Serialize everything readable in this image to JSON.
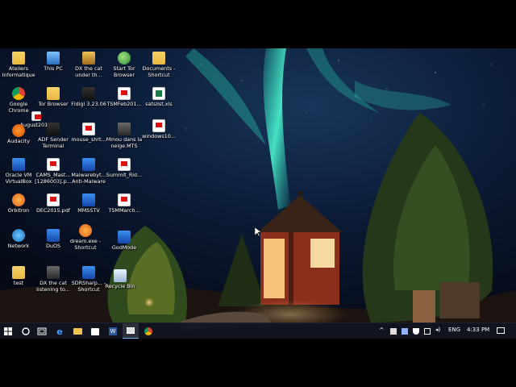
{
  "desktop": {
    "icons": [
      {
        "label": "Ateliers Informatique",
        "icon": "folder-icon"
      },
      {
        "label": "This PC",
        "icon": "computer-icon"
      },
      {
        "label": "DX the cat under th...",
        "icon": "picture-icon"
      },
      {
        "label": "Start Tor Browser",
        "icon": "tor-globe-icon"
      },
      {
        "label": "Documents - Shortcut",
        "icon": "folder-icon"
      },
      {
        "label": "Google Chrome",
        "icon": "chrome-icon"
      },
      {
        "label": "Tor Browser",
        "icon": "folder-icon"
      },
      {
        "label": "Fldigi 3.23.06",
        "icon": "app-icon"
      },
      {
        "label": "TSMFeb201...",
        "icon": "pdf-document-icon"
      },
      {
        "label": "satslist.xls",
        "icon": "excel-document-icon"
      },
      {
        "label": "August201...",
        "icon": "pdf-document-icon"
      },
      {
        "label": "Audacity",
        "icon": "audacity-icon"
      },
      {
        "label": "ADF Sender Terminal",
        "icon": "app-icon"
      },
      {
        "label": "mouse_shrt...",
        "icon": "document-icon"
      },
      {
        "label": "Minou dans la neige.MTS",
        "icon": "video-icon"
      },
      {
        "label": "windows10...",
        "icon": "pdf-document-icon"
      },
      {
        "label": "Oracle VM VirtualBox",
        "icon": "virtualbox-icon"
      },
      {
        "label": "CAMS_Mast... [1286003].p...",
        "icon": "pdf-document-icon"
      },
      {
        "label": "Malwarebyt... Anti-Malware",
        "icon": "malwarebytes-icon"
      },
      {
        "label": "Summit_Rid...",
        "icon": "pdf-document-icon"
      },
      {
        "label": "Orbitron",
        "icon": "orbitron-icon"
      },
      {
        "label": "DEC2015.pdf",
        "icon": "pdf-document-icon"
      },
      {
        "label": "MMSSTV",
        "icon": "app-icon"
      },
      {
        "label": "TSMMarch...",
        "icon": "pdf-document-icon"
      },
      {
        "label": "Network",
        "icon": "network-icon"
      },
      {
        "label": "DuOS",
        "icon": "app-icon"
      },
      {
        "label": "dream.exe - Shortcut",
        "icon": "app-icon"
      },
      {
        "label": "GodMode",
        "icon": "folder-icon"
      },
      {
        "label": "test",
        "icon": "document-icon"
      },
      {
        "label": "DX the cat listening to...",
        "icon": "picture-icon"
      },
      {
        "label": "SDRSharp... - Shortcut",
        "icon": "app-icon"
      },
      {
        "label": "Recycle Bin",
        "icon": "recycle-bin-icon"
      }
    ]
  },
  "taskbar": {
    "language": "ENG",
    "clock": "4:33 PM",
    "pinned": [
      "start-button",
      "cortana-button",
      "task-view-button",
      "edge-icon",
      "file-explorer-icon",
      "store-icon",
      "word-icon",
      "active-window-icon",
      "chrome-icon"
    ]
  },
  "colors": {
    "taskbar_bg": "#101420",
    "aurora": "#3ef0c8",
    "sky": "#0a1a3a"
  }
}
